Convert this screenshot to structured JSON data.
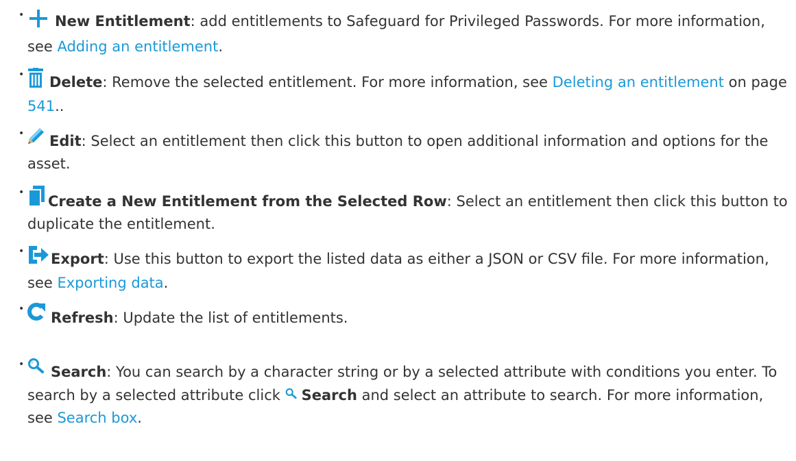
{
  "colors": {
    "text": "#333333",
    "link": "#1a99d8",
    "icon": "#1a99d8"
  },
  "items": [
    {
      "icon": "plus-icon",
      "title": "New Entitlement",
      "desc_1": ": add entitlements to Safeguard for Privileged Passwords. For more information, see ",
      "link_1": "Adding an entitlement",
      "desc_2": "."
    },
    {
      "icon": "trash-icon",
      "title": "Delete",
      "desc_1": ": Remove the selected entitlement. For more information, see ",
      "link_1": "Deleting an entitlement",
      "desc_2": " on page ",
      "link_2": "541",
      "desc_3": ".."
    },
    {
      "icon": "pencil-icon",
      "title": "Edit",
      "desc_1": ": Select an entitlement then click this button to open additional information and options for the asset."
    },
    {
      "icon": "duplicate-icon",
      "title": "Create a New Entitlement from the Selected Row",
      "desc_1": ": Select an entitlement then click this button to duplicate the entitlement."
    },
    {
      "icon": "export-icon",
      "title": "Export",
      "desc_1": ": Use this button to export the listed data as either a JSON or CSV file. For more information, see ",
      "link_1": "Exporting data",
      "desc_2": "."
    },
    {
      "icon": "refresh-icon",
      "title": "Refresh",
      "desc_1": ": Update the list of entitlements."
    },
    {
      "icon": "search-icon",
      "title": "Search",
      "desc_1": ": You can search by a character string or by a selected attribute with conditions you enter. To search by a selected attribute click ",
      "inline_title": "Search",
      "desc_2": " and select an attribute to search. For more information, see ",
      "link_1": "Search box",
      "desc_3": "."
    }
  ]
}
